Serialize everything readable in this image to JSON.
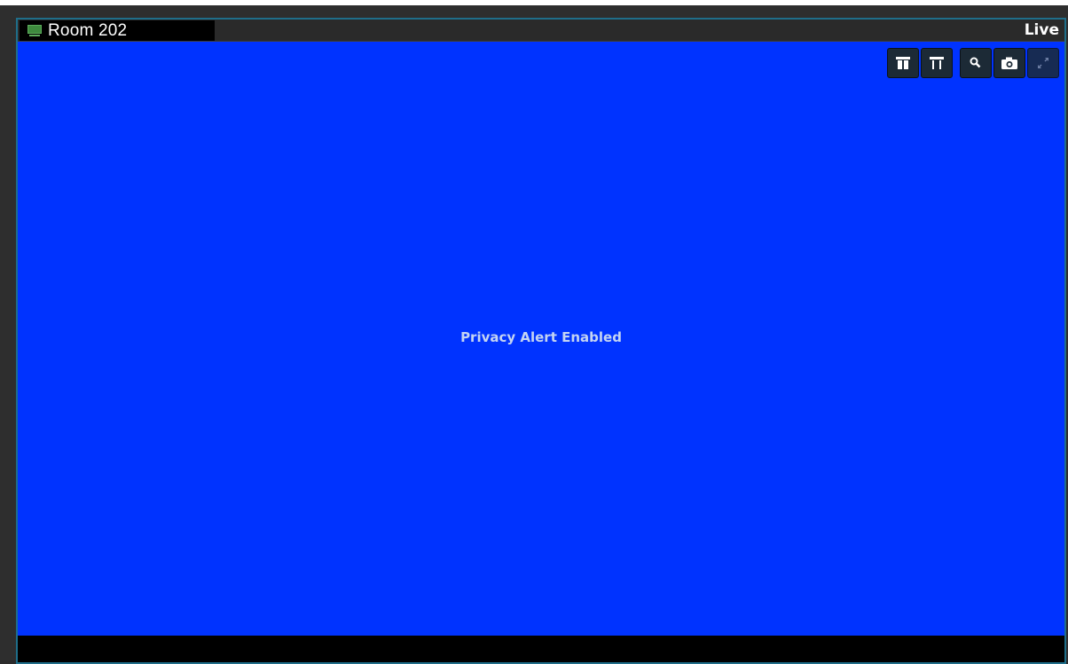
{
  "viewer": {
    "camera_name": "Room 202",
    "mode": "Live",
    "message": "Privacy Alert Enabled"
  },
  "toolbar": {
    "buttons": [
      {
        "name": "preset-up-button",
        "icon": "ptz-tilt-up-icon"
      },
      {
        "name": "preset-down-button",
        "icon": "ptz-tilt-down-icon"
      },
      {
        "name": "zoom-button",
        "icon": "magnifier-icon"
      },
      {
        "name": "snapshot-button",
        "icon": "camera-icon"
      },
      {
        "name": "fullscreen-button",
        "icon": "expand-icon"
      }
    ]
  },
  "colors": {
    "video_background": "#0033ff",
    "message_text": "#c4d4f2",
    "frame_border": "#1f6e8a",
    "status_icon": "#3e8a3e"
  }
}
